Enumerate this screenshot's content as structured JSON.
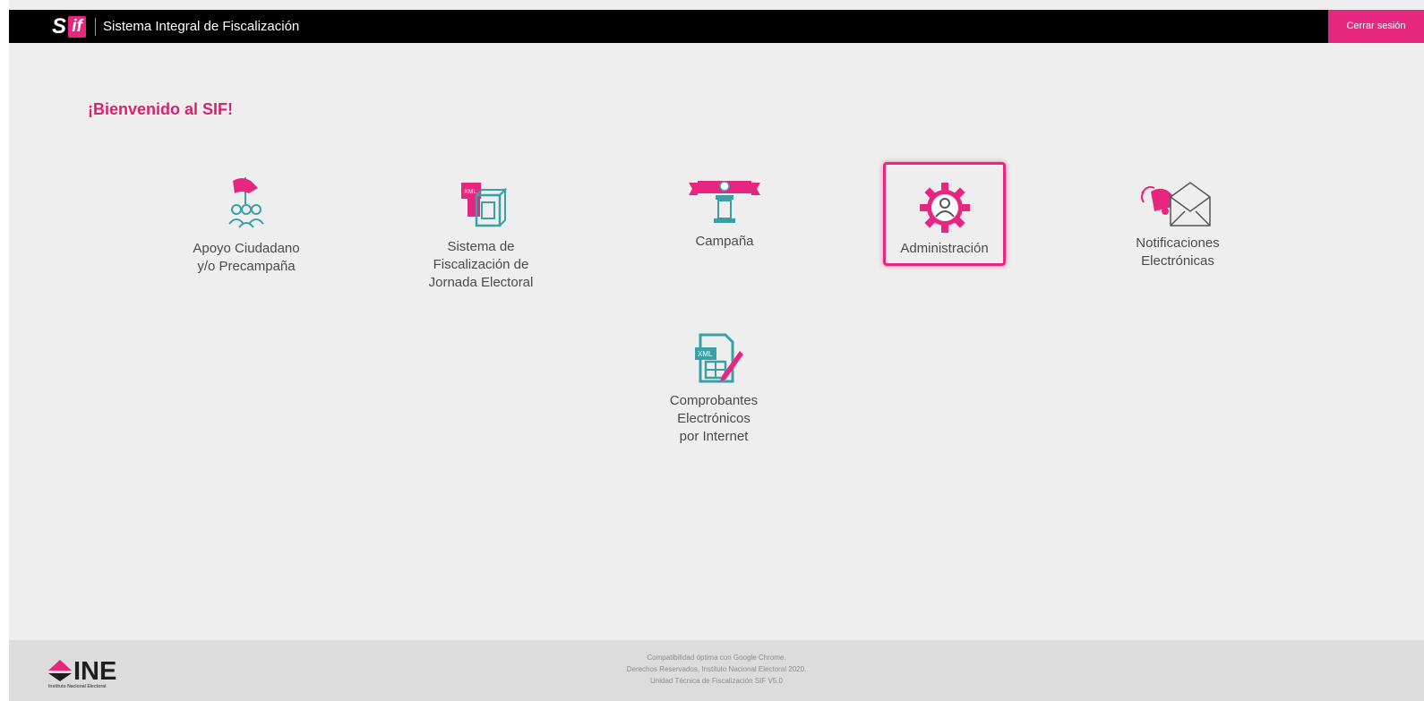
{
  "header": {
    "logo_s": "S",
    "logo_if": "if",
    "title": "Sistema Integral de Fiscalización",
    "logout_label": "Cerrar sesión"
  },
  "welcome": "¡Bienvenido al SIF!",
  "modules": [
    {
      "id": "apoyo",
      "label_lines": [
        "Apoyo Ciudadano",
        "y/o Precampaña"
      ],
      "icon": "flag-people-icon",
      "selected": false
    },
    {
      "id": "jornada",
      "label_lines": [
        "Sistema de",
        "Fiscalización de",
        "Jornada Electoral"
      ],
      "icon": "xml-ballot-box-icon",
      "selected": false
    },
    {
      "id": "campana",
      "label_lines": [
        "Campaña"
      ],
      "icon": "podium-banner-icon",
      "selected": false
    },
    {
      "id": "admin",
      "label_lines": [
        "Administración"
      ],
      "icon": "gear-user-icon",
      "selected": true
    },
    {
      "id": "notificaciones",
      "label_lines": [
        "Notificaciones",
        "Electrónicas"
      ],
      "icon": "bell-envelope-icon",
      "selected": false
    },
    {
      "id": "comprobantes",
      "label_lines": [
        "Comprobantes",
        "Electrónicos",
        "por Internet"
      ],
      "icon": "xml-document-pen-icon",
      "selected": false
    }
  ],
  "footer": {
    "logo_text": "INE",
    "logo_subtitle": "Instituto Nacional Electoral",
    "lines": [
      "Compatibilidad óptima con Google Chrome.",
      "Derechos Reservados, Instituto Nacional Electoral 2020.",
      "Unidad Técnica de Fiscalización SIF V5.0"
    ]
  },
  "colors": {
    "accent": "#e6267f",
    "teal": "#3aa0a6",
    "header_bg": "#000000",
    "page_bg": "#eeeeee"
  }
}
